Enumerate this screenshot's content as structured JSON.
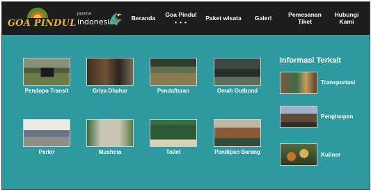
{
  "brand": {
    "logo_text": "GOA PINDUL",
    "partner_small": "pesona",
    "partner_big": "indonesia"
  },
  "nav": {
    "items": [
      {
        "label": "Beranda"
      },
      {
        "label": "Goa Pindul",
        "indicator": "• • •"
      },
      {
        "label": "Paket wisata"
      },
      {
        "label": "Galeri"
      },
      {
        "label": "Pemesanan Tiket"
      },
      {
        "label": "Hubungi Kami"
      }
    ]
  },
  "gallery": [
    {
      "label": "Pendopo Transit"
    },
    {
      "label": "Griya Dhahar"
    },
    {
      "label": "Pendaftaran"
    },
    {
      "label": "Omah Outbond"
    },
    {
      "label": "Parkir"
    },
    {
      "label": "Mushola"
    },
    {
      "label": "Toilet"
    },
    {
      "label": "Penitipan Barang"
    }
  ],
  "sidebar": {
    "title": "Informasi Terkait",
    "items": [
      {
        "label": "Transportasi"
      },
      {
        "label": "Penginapan"
      },
      {
        "label": "Kuliner"
      }
    ]
  },
  "colors": {
    "background": "#2d9aa0",
    "navbar": "#1d1d1d",
    "logo": "#e9b43a"
  }
}
